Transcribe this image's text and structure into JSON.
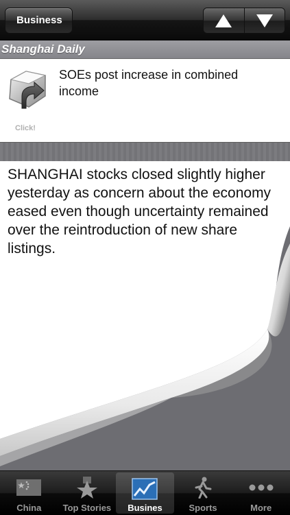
{
  "navbar": {
    "back_label": "Business",
    "up_label": "▲",
    "down_label": "▼"
  },
  "section": {
    "title": "Shanghai Daily"
  },
  "article": {
    "headline": "SOEs post increase in combined income",
    "click_label": "Click!"
  },
  "content": {
    "body": "SHANGHAI stocks closed slightly higher yesterday as concern about the economy eased even though uncertainty remained over the reintroduction of new share listings."
  },
  "tabs": [
    {
      "label": "China",
      "icon": "china-flag-icon"
    },
    {
      "label": "Top Stories",
      "icon": "star-icon"
    },
    {
      "label": "Busines",
      "icon": "chart-icon",
      "active": true
    },
    {
      "label": "Sports",
      "icon": "sports-icon"
    },
    {
      "label": "More",
      "icon": "more-icon"
    }
  ]
}
